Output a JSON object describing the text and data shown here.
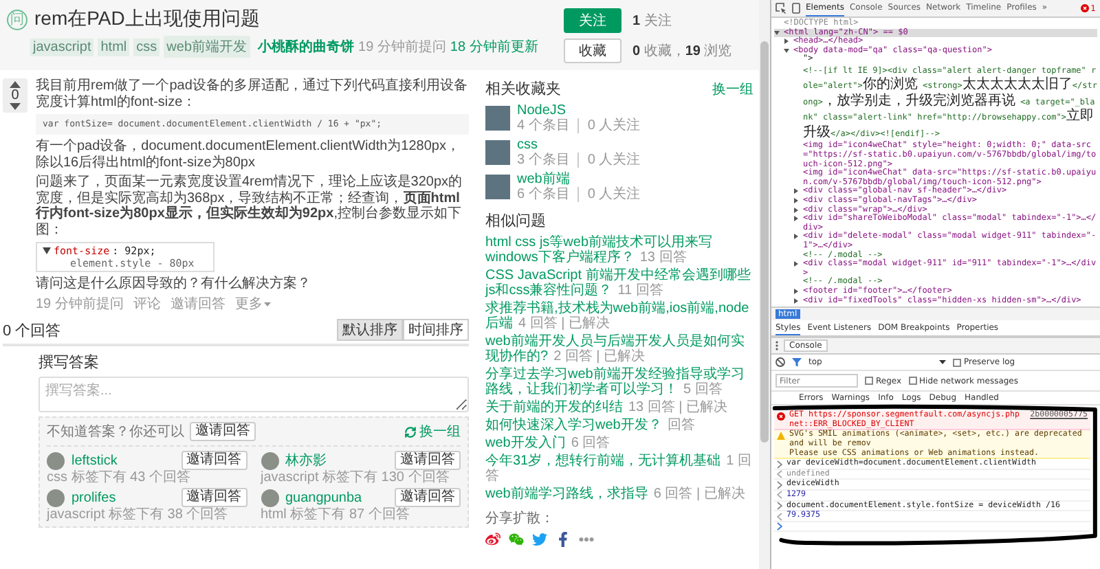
{
  "question": {
    "badge": "问",
    "title": "rem在PAD上出现使用问题",
    "tags": [
      "javascript",
      "html",
      "css",
      "web前端开发"
    ],
    "author": "小桃酥的曲奇饼",
    "asked": "19 分钟前提问",
    "updated": "18 分钟前更新",
    "votes": "0",
    "paragraph_1": "我目前用rem做了一个pad设备的多屏适配，通过下列代码直接利用设备宽度计算html的font-size：",
    "code": "var fontSize= document.documentElement.clientWidth / 16 + \"px\";",
    "paragraph_2": "有一个pad设备，document.documentElement.clientWidth为1280px，除以16后得出html的font-size为80px",
    "paragraph_3": "问题来了，页面某一元素宽度设置4rem情况下，理论上应该是320px的宽度，但是实际宽高却为368px，导致结构不正常；经查询，**页面html行内font-size为80px显示，但实际生效却为92px**,控制台参数显示如下图：",
    "screenshot_lines": [
      {
        "kind": "property",
        "name": "font-size",
        "value": ": 92px;"
      },
      {
        "kind": "source",
        "text": "element.style - 80px"
      }
    ],
    "paragraph_4": "请问这是什么原因导致的？有什么解决方案？",
    "actions": [
      {
        "kind": "time",
        "label": "19 分钟前提问"
      },
      {
        "kind": "link",
        "label": "评论"
      },
      {
        "kind": "link",
        "label": "邀请回答"
      },
      {
        "kind": "menu",
        "label": "更多"
      }
    ]
  },
  "answers": {
    "count": "0 个回答",
    "sort": [
      {
        "label": "默认排序",
        "selected": true
      },
      {
        "label": "时间排序",
        "selected": false
      }
    ]
  },
  "compose": {
    "heading": "撰写答案",
    "placeholder": "撰写答案..."
  },
  "invite": {
    "prompt": "不知道答案？你还可以",
    "button": "邀请回答",
    "refresh": "换一组",
    "users": [
      {
        "name": "leftstick",
        "meta": "css 标签下有 43 个回答",
        "button": "邀请回答"
      },
      {
        "name": "林亦影",
        "meta": "javascript 标签下有 130 个回答",
        "button": "邀请回答"
      },
      {
        "name": "prolifes",
        "meta": "javascript 标签下有 38 个回答",
        "button": "邀请回答"
      },
      {
        "name": "guangpunba",
        "meta": "html 标签下有 87 个回答",
        "button": "邀请回答"
      }
    ]
  },
  "sidebar": {
    "follow": {
      "button": "关注",
      "text": "**1** 关注"
    },
    "collect": {
      "button": "收藏",
      "text": "**0** 收藏，**19** 浏览"
    },
    "collections": {
      "heading": "相关收藏夹",
      "refresh": "换一组",
      "items": [
        {
          "name": "NodeJS",
          "entries": "4 个条目",
          "followers": "0 人关注"
        },
        {
          "name": "css",
          "entries": "3 个条目",
          "followers": "0 人关注"
        },
        {
          "name": "web前端",
          "entries": "6 个条目",
          "followers": "0 人关注"
        }
      ]
    },
    "similar": {
      "heading": "相似问题",
      "items": [
        {
          "title": "html css js等web前端技术可以用来写windows下客户端程序？",
          "meta": "13 回答"
        },
        {
          "title": "CSS JavaScript 前端开发中经常会遇到哪些js和css兼容性问题？",
          "meta": "11 回答"
        },
        {
          "title": "求推荐书籍,技术栈为web前端,ios前端,node后端",
          "meta": "4 回答 | 已解决"
        },
        {
          "title": "web前端开发人员与后端开发人员是如何实现协作的?",
          "meta": "2 回答 | 已解决"
        },
        {
          "title": "分享过去学习web前端开发经验指导或学习路线，让我们初学者可以学习！",
          "meta": "5 回答"
        },
        {
          "title": "关于前端的开发的纠结",
          "meta": "13 回答 | 已解决"
        },
        {
          "title": "如何快速深入学习web开发？",
          "meta": "回答"
        },
        {
          "title": "web开发入门",
          "meta": "6 回答"
        },
        {
          "title": "今年31岁，想转行前端，无计算机基础",
          "meta": "1 回答"
        },
        {
          "title": "web前端学习路线，求指导",
          "meta": "6 回答 | 已解决"
        }
      ]
    },
    "share": {
      "label": "分享扩散："
    }
  },
  "devtools": {
    "tabs": [
      {
        "label": "Elements",
        "selected": true
      },
      {
        "label": "Console",
        "selected": false
      },
      {
        "label": "Sources",
        "selected": false
      },
      {
        "label": "Network",
        "selected": false
      },
      {
        "label": "Timeline",
        "selected": false
      },
      {
        "label": "Profiles",
        "selected": false
      }
    ],
    "overflow": "»",
    "error_count": "1",
    "dom_tree": [
      {
        "kind": "doctype",
        "text": "<!DOCTYPE html>",
        "selected": false
      },
      {
        "kind": "tag",
        "text": "<html lang=\"zh-CN\"> == $0",
        "selected": true,
        "expanded": true,
        "children": [
          {
            "kind": "tag",
            "text": "<head>…</head>",
            "expanded": false
          },
          {
            "kind": "tag",
            "text": "<body data-mod=\"qa\" class=\"qa-question\">",
            "expanded": true,
            "children": [
              {
                "kind": "text",
                "text": "\">"
              },
              {
                "kind": "markup",
                "segments": [
                  {
                    "kind": "code",
                    "text": "<!--[if lt IE 9]><div class=\"alert alert-danger topframe\" role=\"alert\">"
                  },
                  {
                    "kind": "cjk",
                    "text": "你的浏览"
                  },
                  {
                    "kind": "code",
                    "text": " <strong>"
                  },
                  {
                    "kind": "cjk",
                    "text": "太太太太太太旧了"
                  },
                  {
                    "kind": "code",
                    "text": "</strong>"
                  },
                  {
                    "kind": "cjk",
                    "text": "，放学别走，升级完浏览器再说"
                  },
                  {
                    "kind": "code",
                    "text": " <a target=\"_blank\" class=\"alert-link\" href=\"http://browsehappy.com\">"
                  },
                  {
                    "kind": "cjk",
                    "text": "立即升级"
                  },
                  {
                    "kind": "code",
                    "text": "</a></div><![endif]-->"
                  }
                ]
              },
              {
                "kind": "tag",
                "text": "<img id=\"icon4weChat\" style=\"height: 0;width: 0;\" data-src=\"https://sf-static.b0.upaiyun.com/v-5767bbdb/global/img/touch-icon-512.png\">"
              },
              {
                "kind": "tag",
                "text": "<img id=\"icon4weChat\" data-src=\"https://sf-static.b0.upaiyun.com/v-5767bbdb/global/img/touch-icon-512.png\">"
              },
              {
                "kind": "tag",
                "text": "<div class=\"global-nav sf-header\">…</div>",
                "expanded": false
              },
              {
                "kind": "tag",
                "text": "<div class=\"global-navTags\">…</div>",
                "expanded": false
              },
              {
                "kind": "tag",
                "text": "<div class=\"wrap\">…</div>",
                "expanded": false
              },
              {
                "kind": "tag",
                "text": "<div id=\"shareToWeiboModal\" class=\"modal\" tabindex=\"-1\">…</div>",
                "expanded": false
              },
              {
                "kind": "tag",
                "text": "<div id=\"delete-modal\" class=\"modal widget-911\" tabindex=\"-1\">…</div>",
                "expanded": false
              },
              {
                "kind": "comment",
                "text": "<!-- /.modal -->"
              },
              {
                "kind": "tag",
                "text": "<div class=\"modal widget-911\" id=\"911\" tabindex=\"-1\">…</div>",
                "expanded": false
              },
              {
                "kind": "comment",
                "text": "<!-- /.modal -->"
              },
              {
                "kind": "tag",
                "text": "<footer id=\"footer\">…</footer>",
                "expanded": false
              },
              {
                "kind": "tag",
                "text": "<div id=\"fixedTools\" class=\"hidden-xs hidden-sm\">…</div>",
                "expanded": false
              }
            ]
          }
        ]
      }
    ],
    "breadcrumb": [
      {
        "label": "html",
        "selected": true
      }
    ],
    "panel_tabs": [
      {
        "label": "Styles",
        "selected": true
      },
      {
        "label": "Event Listeners",
        "selected": false
      },
      {
        "label": "DOM Breakpoints",
        "selected": false
      },
      {
        "label": "Properties",
        "selected": false
      }
    ],
    "drawer_tab": "Console",
    "context": "top",
    "preserve_log": {
      "label": "Preserve log",
      "checked": false
    },
    "filter": {
      "placeholder": "Filter"
    },
    "regex": {
      "label": "Regex",
      "checked": false
    },
    "hide_network": {
      "label": "Hide network messages",
      "checked": false
    },
    "levels": [
      "Errors",
      "Warnings",
      "Info",
      "Logs",
      "Debug",
      "Handled"
    ],
    "messages": [
      {
        "kind": "error",
        "text": "GET https://sponsor.segmentfault.com/asyncjs.php",
        "detail": "net::ERR_BLOCKED_BY_CLIENT",
        "source": "2b0000005775"
      },
      {
        "kind": "warning",
        "text": "SVG's SMIL animations (<animate>, <set>, etc.) are deprecated and will be remov",
        "detail": "Please use CSS animations or Web animations instead."
      },
      {
        "kind": "input",
        "text": "var deviceWidth=document.documentElement.clientWidth"
      },
      {
        "kind": "result",
        "text": "undefined"
      },
      {
        "kind": "input",
        "text": "deviceWidth"
      },
      {
        "kind": "value",
        "text": "1279"
      },
      {
        "kind": "input",
        "text": "document.documentElement.style.fontSize = deviceWidth /16"
      },
      {
        "kind": "value",
        "text": "79.9375"
      },
      {
        "kind": "prompt"
      }
    ]
  }
}
